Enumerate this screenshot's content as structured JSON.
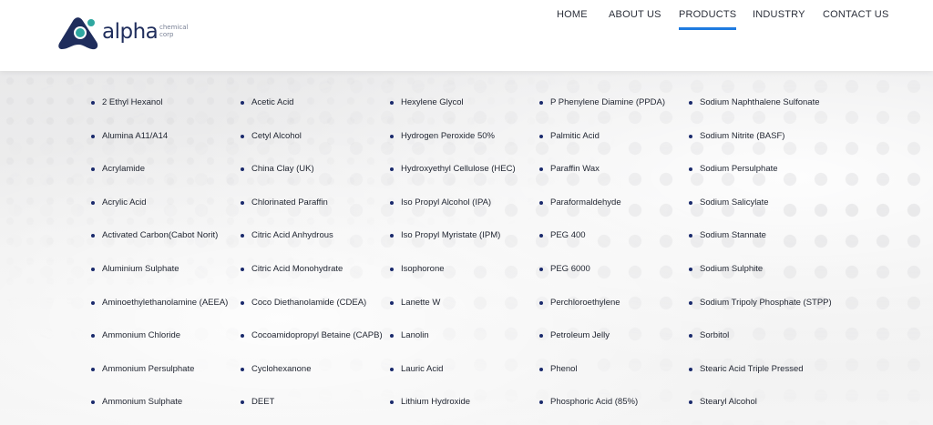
{
  "header": {
    "logo": {
      "word": "alpha",
      "sub": "chemical corp"
    },
    "nav": [
      {
        "label": "HOME"
      },
      {
        "label": "ABOUT US"
      },
      {
        "label": "PRODUCTS",
        "active": true
      },
      {
        "label": "INDUSTRY"
      },
      {
        "label": "CONTACT US"
      }
    ]
  },
  "products": {
    "columns": [
      [
        "2 Ethyl Hexanol",
        "Alumina A11/A14",
        "Acrylamide",
        "Acrylic Acid",
        "Activated Carbon(Cabot Norit)",
        "Aluminium Sulphate",
        "Aminoethylethanolamine (AEEA)",
        "Ammonium Chloride",
        "Ammonium Persulphate",
        "Ammonium Sulphate"
      ],
      [
        "Acetic Acid",
        "Cetyl Alcohol",
        "China Clay (UK)",
        "Chlorinated Paraffin",
        "Citric Acid Anhydrous",
        "Citric Acid Monohydrate",
        "Coco Diethanolamide (CDEA)",
        "Cocoamidopropyl Betaine (CAPB)",
        "Cyclohexanone",
        "DEET"
      ],
      [
        "Hexylene Glycol",
        "Hydrogen Peroxide 50%",
        "Hydroxyethyl Cellulose (HEC)",
        "Iso Propyl Alcohol (IPA)",
        "Iso Propyl Myristate (IPM)",
        "Isophorone",
        "Lanette W",
        "Lanolin",
        "Lauric Acid",
        "Lithium Hydroxide"
      ],
      [
        "P Phenylene Diamine (PPDA)",
        "Palmitic Acid",
        "Paraffin Wax",
        "Paraformaldehyde",
        "PEG 400",
        "PEG 6000",
        "Perchloroethylene",
        "Petroleum Jelly",
        "Phenol",
        "Phosphoric Acid (85%)"
      ],
      [
        "Sodium Naphthalene Sulfonate",
        "Sodium Nitrite (BASF)",
        "Sodium Persulphate",
        "Sodium Salicylate",
        "Sodium Stannate",
        "Sodium Sulphite",
        "Sodium Tripoly Phosphate (STPP)",
        "Sorbitol",
        "Stearic Acid Triple Pressed",
        "Stearyl Alcohol"
      ]
    ]
  },
  "colors": {
    "brand_navy": "#1f2d5c",
    "brand_teal": "#2fa7a0",
    "accent_blue": "#1e7be0",
    "bullet": "#1a2a6c"
  },
  "icons": {
    "logo": "alpha-triangle-logo-icon"
  }
}
